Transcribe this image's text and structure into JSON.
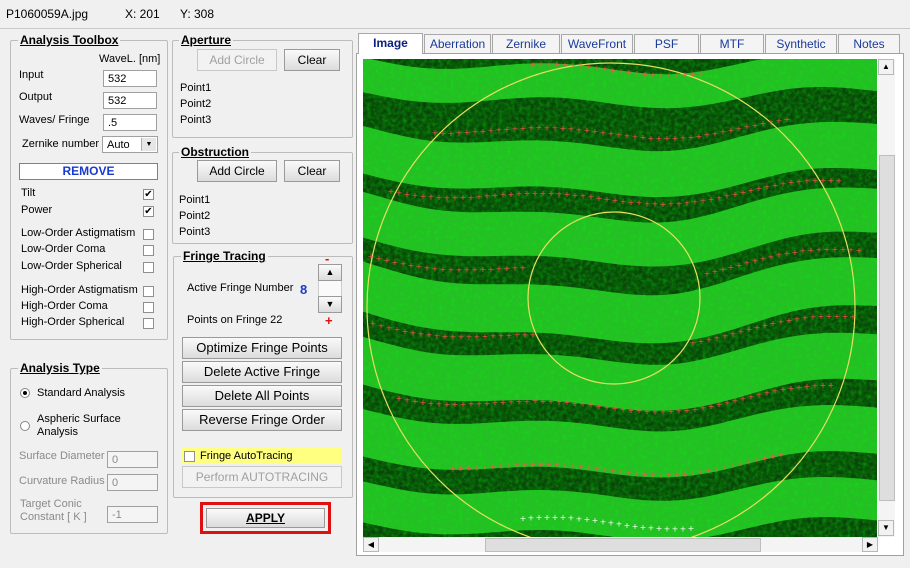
{
  "titlebar": {
    "filename": "P1060059A.jpg",
    "x": "X: 201",
    "y": "Y: 308"
  },
  "toolbox": {
    "title": "Analysis Toolbox",
    "wavelength_header": "WaveL. [nm]",
    "input_label": "Input",
    "input_value": "532",
    "output_label": "Output",
    "output_value": "532",
    "waves_label": "Waves/ Fringe",
    "waves_value": ".5",
    "zernike_label": "Zernike number",
    "zernike_value": "Auto",
    "remove_label": "REMOVE",
    "terms": [
      {
        "label": "Tilt",
        "checked": true
      },
      {
        "label": "Power",
        "checked": true
      },
      {
        "label": "Low-Order  Astigmatism",
        "checked": false
      },
      {
        "label": "Low-Order  Coma",
        "checked": false
      },
      {
        "label": "Low-Order  Spherical",
        "checked": false
      },
      {
        "label": "High-Order  Astigmatism",
        "checked": false
      },
      {
        "label": "High-Order  Coma",
        "checked": false
      },
      {
        "label": "High-Order  Spherical",
        "checked": false
      }
    ],
    "check_mark": "✔"
  },
  "analysis_type": {
    "title": "Analysis Type",
    "standard": "Standard  Analysis",
    "aspheric_line1": "Aspheric  Surface",
    "aspheric_line2": "Analysis",
    "surface_diameter_label": "Surface Diameter",
    "surface_diameter_value": "0",
    "curvature_radius_label": "Curvature Radius",
    "curvature_radius_value": "0",
    "conic_label_1": "Target Conic",
    "conic_label_2": "Constant [ K ]",
    "conic_value": "-1"
  },
  "aperture": {
    "title": "Aperture",
    "add_circle": "Add Circle",
    "clear": "Clear",
    "points": [
      "Point1",
      "Point2",
      "Point3"
    ]
  },
  "obstruction": {
    "title": "Obstruction",
    "add_circle": "Add Circle",
    "clear": "Clear",
    "points": [
      "Point1",
      "Point2",
      "Point3"
    ]
  },
  "fringe": {
    "title": "Fringe Tracing",
    "active_label": "Active Fringe Number",
    "active_value": "8",
    "points_label": "Points on  Fringe 22",
    "minus": "-",
    "plus": "+",
    "up_arrow": "▲",
    "down_arrow": "▼",
    "optimize": "Optimize Fringe Points",
    "delete_active": "Delete Active Fringe",
    "delete_all": "Delete  All  Points",
    "reverse": "Reverse  Fringe Order",
    "autotracing_label": "Fringe AutoTracing",
    "perform": "Perform  AUTOTRACING"
  },
  "apply": "APPLY",
  "tabs": [
    "Image",
    "Aberration",
    "Zernike",
    "WaveFront",
    "PSF",
    "MTF",
    "Synthetic",
    "Notes"
  ],
  "colors": {
    "fringe_bright": "#2fc82f",
    "fringe_dark": "#082a08",
    "aperture_circle": "#e8e060",
    "trace_point": "#ff5050",
    "trace_point_last": "#ffffff",
    "apply_border": "#e01010",
    "number_blue": "#1a3acc"
  },
  "scroll": {
    "up": "▲",
    "down": "▼",
    "left": "◀",
    "right": "▶"
  }
}
